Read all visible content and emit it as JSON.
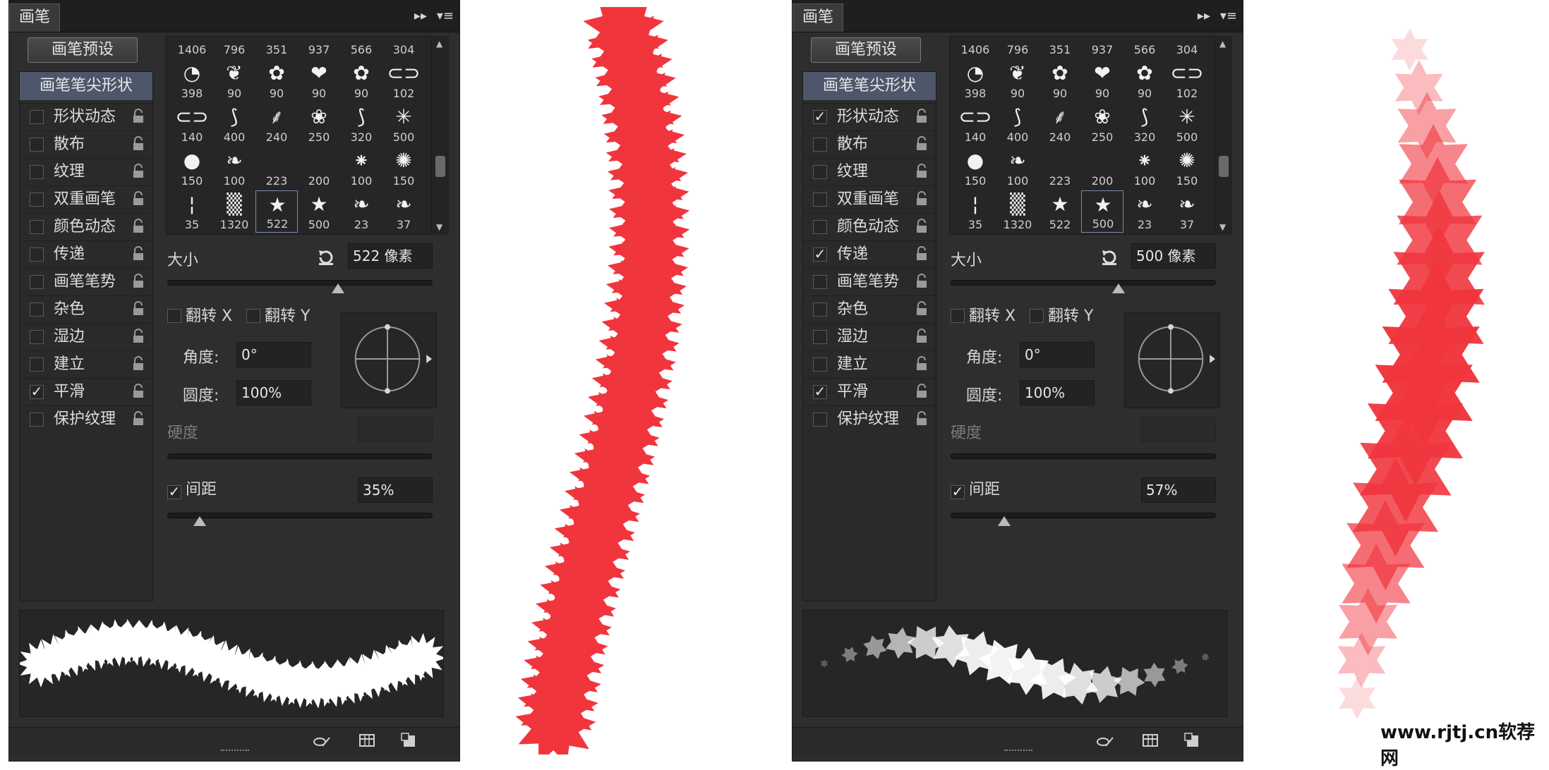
{
  "panels": [
    {
      "tab": "画笔",
      "tab_controls": {
        "collapse": "▸▸",
        "menu": "▾≡"
      },
      "presets_button": "画笔预设",
      "tip_shape": "画笔笔尖形状",
      "options": [
        {
          "label": "形状动态",
          "checked": false
        },
        {
          "label": "散布",
          "checked": false
        },
        {
          "label": "纹理",
          "checked": false
        },
        {
          "label": "双重画笔",
          "checked": false
        },
        {
          "label": "颜色动态",
          "checked": false
        },
        {
          "label": "传递",
          "checked": false
        },
        {
          "label": "画笔笔势",
          "checked": false
        },
        {
          "label": "杂色",
          "checked": false
        },
        {
          "label": "湿边",
          "checked": false
        },
        {
          "label": "建立",
          "checked": false
        },
        {
          "label": "平滑",
          "checked": true
        },
        {
          "label": "保护纹理",
          "checked": false
        }
      ],
      "brush_sizes": [
        "1406",
        "796",
        "351",
        "937",
        "566",
        "304",
        "398",
        "90",
        "90",
        "90",
        "90",
        "102",
        "140",
        "400",
        "240",
        "250",
        "320",
        "500",
        "150",
        "100",
        "223",
        "200",
        "100",
        "150",
        "35",
        "1320",
        "522",
        "500",
        "23",
        "37"
      ],
      "brush_icons": [
        "dots-brush-icon",
        "dots-brush-icon",
        "dots-brush-icon",
        "dots-brush-icon",
        "dots-brush-icon",
        "dots-brush-icon",
        "fan-brush-icon",
        "ornament-brush-icon",
        "lace-brush-icon",
        "heart-brush-icon",
        "lace-brush-icon",
        "chain-brush-icon",
        "chain-brush-icon",
        "grass-brush-icon",
        "plant-brush-icon",
        "floral-brush-icon",
        "grass-brush-icon",
        "sparkle-brush-icon",
        "round-brush-icon",
        "leaf-brush-icon",
        "empty-brush-icon",
        "empty-brush-icon",
        "splash-brush-icon",
        "splatter-brush-icon",
        "line-brush-icon",
        "texture-brush-icon",
        "star-brush-icon",
        "star-brush-icon",
        "leaf-brush-icon",
        "leaf-brush-icon"
      ],
      "selected_index": 26,
      "size_label": "大小",
      "size_value": "522 像素",
      "size_slider": 0.64,
      "flip_x": "翻转 X",
      "flip_y": "翻转 Y",
      "angle_label": "角度:",
      "angle_value": "0°",
      "roundness_label": "圆度:",
      "roundness_value": "100%",
      "hardness_label": "硬度",
      "spacing_label": "间距",
      "spacing_checked": true,
      "spacing_value": "35%",
      "spacing_slider": 0.12,
      "preview_style": "solid"
    },
    {
      "tab": "画笔",
      "tab_controls": {
        "collapse": "▸▸",
        "menu": "▾≡"
      },
      "presets_button": "画笔预设",
      "tip_shape": "画笔笔尖形状",
      "options": [
        {
          "label": "形状动态",
          "checked": true
        },
        {
          "label": "散布",
          "checked": false
        },
        {
          "label": "纹理",
          "checked": false
        },
        {
          "label": "双重画笔",
          "checked": false
        },
        {
          "label": "颜色动态",
          "checked": false
        },
        {
          "label": "传递",
          "checked": true
        },
        {
          "label": "画笔笔势",
          "checked": false
        },
        {
          "label": "杂色",
          "checked": false
        },
        {
          "label": "湿边",
          "checked": false
        },
        {
          "label": "建立",
          "checked": false
        },
        {
          "label": "平滑",
          "checked": true
        },
        {
          "label": "保护纹理",
          "checked": false
        }
      ],
      "brush_sizes": [
        "1406",
        "796",
        "351",
        "937",
        "566",
        "304",
        "398",
        "90",
        "90",
        "90",
        "90",
        "102",
        "140",
        "400",
        "240",
        "250",
        "320",
        "500",
        "150",
        "100",
        "223",
        "200",
        "100",
        "150",
        "35",
        "1320",
        "522",
        "500",
        "23",
        "37"
      ],
      "brush_icons": [
        "dots-brush-icon",
        "dots-brush-icon",
        "dots-brush-icon",
        "dots-brush-icon",
        "dots-brush-icon",
        "dots-brush-icon",
        "fan-brush-icon",
        "ornament-brush-icon",
        "lace-brush-icon",
        "heart-brush-icon",
        "lace-brush-icon",
        "chain-brush-icon",
        "chain-brush-icon",
        "grass-brush-icon",
        "plant-brush-icon",
        "floral-brush-icon",
        "grass-brush-icon",
        "sparkle-brush-icon",
        "round-brush-icon",
        "leaf-brush-icon",
        "empty-brush-icon",
        "empty-brush-icon",
        "splash-brush-icon",
        "splatter-brush-icon",
        "line-brush-icon",
        "texture-brush-icon",
        "star-brush-icon",
        "star-brush-icon",
        "leaf-brush-icon",
        "leaf-brush-icon"
      ],
      "selected_index": 27,
      "size_label": "大小",
      "size_value": "500 像素",
      "size_slider": 0.63,
      "flip_x": "翻转 X",
      "flip_y": "翻转 Y",
      "angle_label": "角度:",
      "angle_value": "0°",
      "roundness_label": "圆度:",
      "roundness_value": "100%",
      "hardness_label": "硬度",
      "spacing_label": "间距",
      "spacing_checked": true,
      "spacing_value": "57%",
      "spacing_slider": 0.2,
      "preview_style": "faded"
    }
  ],
  "colors": {
    "stroke_red": "#f0353d",
    "panel_bg": "#2e2e2e",
    "highlight": "#4d566a"
  },
  "watermark": "www.rjtj.cn软荐网"
}
